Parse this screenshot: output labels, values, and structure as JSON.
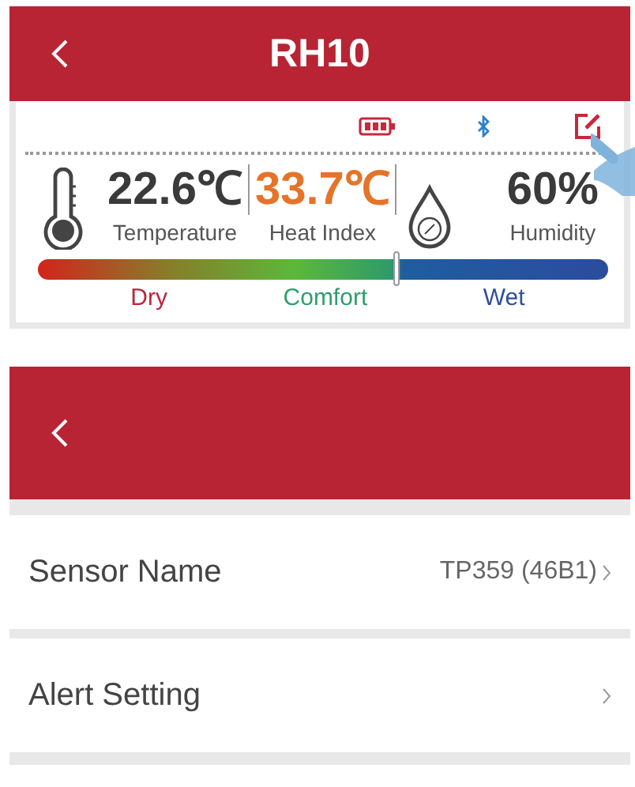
{
  "screens": [
    {
      "kind": "dashboard",
      "title": "RH10",
      "readings": [
        {
          "kind": "temperature",
          "value": "22.6℃",
          "label": "Temperature"
        },
        {
          "kind": "heat_index",
          "value": "33.7℃",
          "label": "Heat Index"
        },
        {
          "kind": "humidity",
          "value": "60%",
          "label": "Humidity"
        }
      ],
      "comfort": {
        "level": 0.63,
        "labels": [
          {
            "text": "Dry",
            "color": "#b8263a"
          },
          {
            "text": "Comfort",
            "color": "#2e9e6e"
          },
          {
            "text": "Wet",
            "color": "#2f4f9a"
          }
        ]
      }
    },
    {
      "kind": "settings",
      "rows": [
        {
          "label": "Sensor Name",
          "value": "TP359 (46B1)"
        },
        {
          "label": "Alert Setting"
        }
      ]
    }
  ]
}
